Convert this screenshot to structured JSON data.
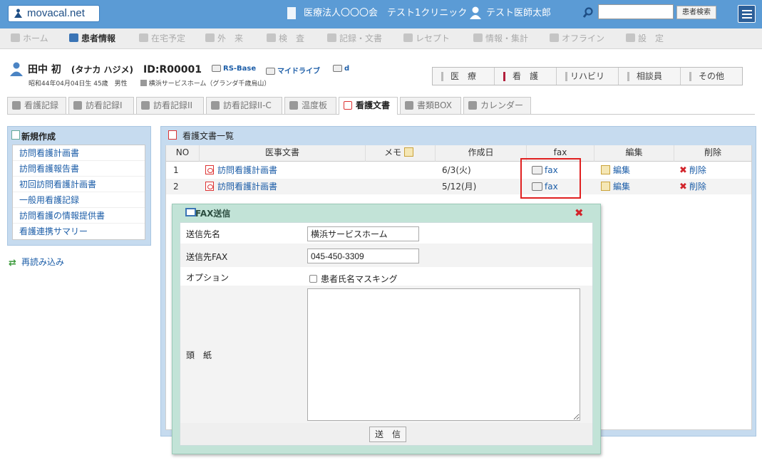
{
  "header": {
    "logo": "movacal.net",
    "clinic": "医療法人〇〇〇会　テスト1クリニック",
    "doctor": "テスト医師太郎",
    "search_value": "",
    "search_button": "患者検索"
  },
  "nav": {
    "items": [
      {
        "label": "ホーム"
      },
      {
        "label": "患者情報"
      },
      {
        "label": "在宅予定"
      },
      {
        "label": "外　来"
      },
      {
        "label": "検　査"
      },
      {
        "label": "記録・文書"
      },
      {
        "label": "レセプト"
      },
      {
        "label": "情報・集計"
      },
      {
        "label": "オフライン"
      },
      {
        "label": "設　定"
      }
    ]
  },
  "patient": {
    "name": "田中 初",
    "kana": "(タナカ ハジメ)",
    "id": "ID:R00001",
    "link1": "RS-Base",
    "link2": "マイドライブ",
    "link3": "d",
    "info": "昭和44年04月04日生 45歳　男性",
    "facility": "横浜サービスホーム（グランダ千歳烏山）"
  },
  "categories": [
    {
      "label": "医　療"
    },
    {
      "label": "看　護"
    },
    {
      "label": "リハビリ"
    },
    {
      "label": "相談員"
    },
    {
      "label": "その他"
    }
  ],
  "subtabs": [
    {
      "label": "看護記録"
    },
    {
      "label": "訪看記録I"
    },
    {
      "label": "訪看記録II"
    },
    {
      "label": "訪看記録II-C"
    },
    {
      "label": "温度板"
    },
    {
      "label": "看護文書"
    },
    {
      "label": "書類BOX"
    },
    {
      "label": "カレンダー"
    }
  ],
  "sidebar": {
    "title": "新規作成",
    "items": [
      {
        "label": "訪問看護計画書"
      },
      {
        "label": "訪問看護報告書"
      },
      {
        "label": "初回訪問看護計画書"
      },
      {
        "label": "一般用看護記録"
      },
      {
        "label": "訪問看護の情報提供書"
      },
      {
        "label": "看護連携サマリー"
      }
    ],
    "reload": "再読み込み"
  },
  "list": {
    "title": "看護文書一覧",
    "columns": {
      "no": "NO",
      "doc": "医事文書",
      "memo": "メモ",
      "date": "作成日",
      "fax": "fax",
      "edit": "編集",
      "del": "削除"
    },
    "rows": [
      {
        "no": "1",
        "doc": "訪問看護計画書",
        "date": "6/3(火)",
        "fax": "fax",
        "edit": "編集",
        "del": "削除"
      },
      {
        "no": "2",
        "doc": "訪問看護計画書",
        "date": "5/12(月)",
        "fax": "fax",
        "edit": "編集",
        "del": "削除"
      }
    ]
  },
  "fax_modal": {
    "title": "FAX送信",
    "dest_label": "送信先名",
    "dest_value": "横浜サービスホーム",
    "fax_label": "送信先FAX",
    "fax_value": "045-450-3309",
    "option_label": "オプション",
    "mask_label": "患者氏名マスキング",
    "cover_label": "頭　紙",
    "cover_value": "",
    "send": "送　信"
  }
}
